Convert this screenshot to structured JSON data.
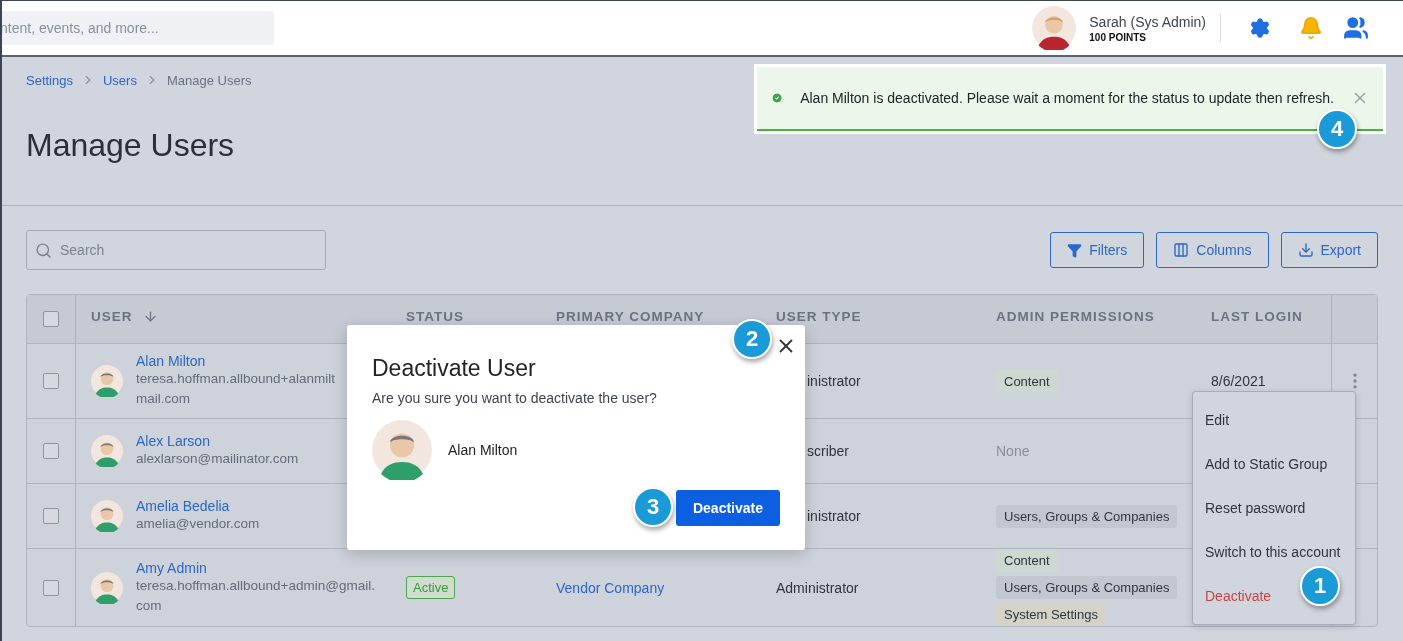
{
  "top_bar": {
    "search": {
      "placeholder": "ntent, events, and more..."
    },
    "user": {
      "name": "Sarah (Sys Admin)",
      "points": "100 POINTS"
    }
  },
  "breadcrumb": [
    {
      "label": "Settings",
      "link": true
    },
    {
      "label": "Users",
      "link": true
    },
    {
      "label": "Manage Users",
      "link": false
    }
  ],
  "title": "Manage Users",
  "search": {
    "placeholder": "Search"
  },
  "actions": [
    {
      "label": "Filters",
      "kind": "filter"
    },
    {
      "label": "Columns",
      "kind": "columns"
    },
    {
      "label": "Export",
      "kind": "export"
    }
  ],
  "table": {
    "columns": [
      "USER",
      "STATUS",
      "PRIMARY COMPANY",
      "USER TYPE",
      "ADMIN PERMISSIONS",
      "LAST LOGIN"
    ],
    "select_all_checked": false,
    "rows": [
      {
        "checked": false,
        "name": "Alan Milton",
        "email_lines": [
          "teresa.hoffman.allbound+alanmilt",
          "mail.com"
        ],
        "under_dialog": true,
        "user_type": "inistrator",
        "permissions": [
          {
            "label": "Content",
            "color": "#ccd8d0"
          }
        ],
        "last_login": "8/6/2021",
        "menu_button": true
      },
      {
        "checked": false,
        "name": "Alex Larson",
        "email_lines": [
          "alexlarson@mailinator.com"
        ],
        "under_dialog": true,
        "user_type": "scriber",
        "permissions_text": "None",
        "menu_button": false
      },
      {
        "checked": false,
        "name": "Amelia Bedelia",
        "email_lines": [
          "amelia@vendor.com"
        ],
        "under_dialog": true,
        "user_type": "inistrator",
        "permissions": [
          {
            "label": "Users, Groups & Companies",
            "color": "#c3c8d0"
          }
        ],
        "menu_button": false
      },
      {
        "checked": false,
        "name": "Amy Admin",
        "email_lines": [
          "teresa.hoffman.allbound+admin@gmail.",
          "com"
        ],
        "under_dialog": false,
        "status": "Active",
        "company": "Vendor Company",
        "user_type": "Administrator",
        "permissions": [
          {
            "label": "Content",
            "color": "#ccd8d0"
          },
          {
            "label": "Users, Groups & Companies",
            "color": "#c3c8d0"
          },
          {
            "label": "System Settings",
            "color": "#d5d2c7"
          }
        ],
        "menu_button": false
      }
    ]
  },
  "row_menu": [
    {
      "label": "Edit",
      "kind": "normal"
    },
    {
      "label": "Add to Static Group",
      "kind": "normal"
    },
    {
      "label": "Reset password",
      "kind": "normal"
    },
    {
      "label": "Switch to this account",
      "kind": "normal"
    },
    {
      "label": "Deactivate",
      "kind": "danger"
    }
  ],
  "dialog": {
    "title": "Deactivate User",
    "message": "Are you sure you want to deactivate the user?",
    "user_name": "Alan Milton",
    "confirm": "Deactivate"
  },
  "toast": {
    "message": "Alan Milton is deactivated. Please wait a moment for the status to update then refresh."
  },
  "callouts": [
    "1",
    "2",
    "3",
    "4"
  ]
}
